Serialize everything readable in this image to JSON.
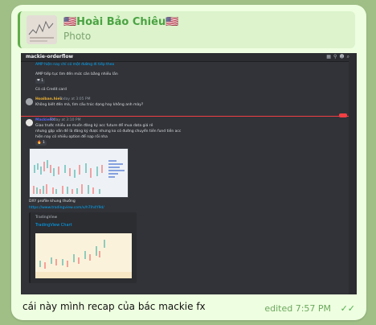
{
  "reply": {
    "sender": "🇺🇸Hoài Bảo Chiêu🇺🇸",
    "type": "Photo"
  },
  "screenshot": {
    "channel": "mackie-orderflow",
    "icons": [
      "threads-icon",
      "pin-icon",
      "members-icon",
      "search-icon"
    ],
    "messages": [
      {
        "text": "AMP hiện nay chỉ có một đường đi tiếp theo"
      },
      {
        "text": "AMP tiếp tục tìm đến mức cân bằng nhiều lần"
      },
      {
        "text": "Có cả Credit card"
      },
      {
        "author": "Hoaiban.hiev",
        "time": "Today at 3:05 PM",
        "text": "Không biết đến mà, tìm cấu trúc dạng hay không anh mày?"
      },
      {
        "author": "MackieFX",
        "time": "Today at 3:10 PM",
        "lines": [
          "Giao trước nhiều ae muốn đăng ký acc future để mua data giá rẻ",
          "nhưng gặp vấn đề là đăng ký được nhưng ko có đường chuyển tiền fund tiền acc",
          "hiện nay có nhiều option để nạp rồi nha"
        ]
      },
      {
        "text": "DXY profile khung thường"
      },
      {
        "link": "https://www.tradingview.com/x/h7Ih4Y9d/"
      }
    ],
    "embed": {
      "site": "TradingView",
      "title": "TradingView Chart"
    }
  },
  "caption": "cái này mình recap của bác mackie fx",
  "meta": "edited 7:57 PM",
  "colors": {
    "accent": "#4aa342",
    "bubble": "#eefee0"
  }
}
